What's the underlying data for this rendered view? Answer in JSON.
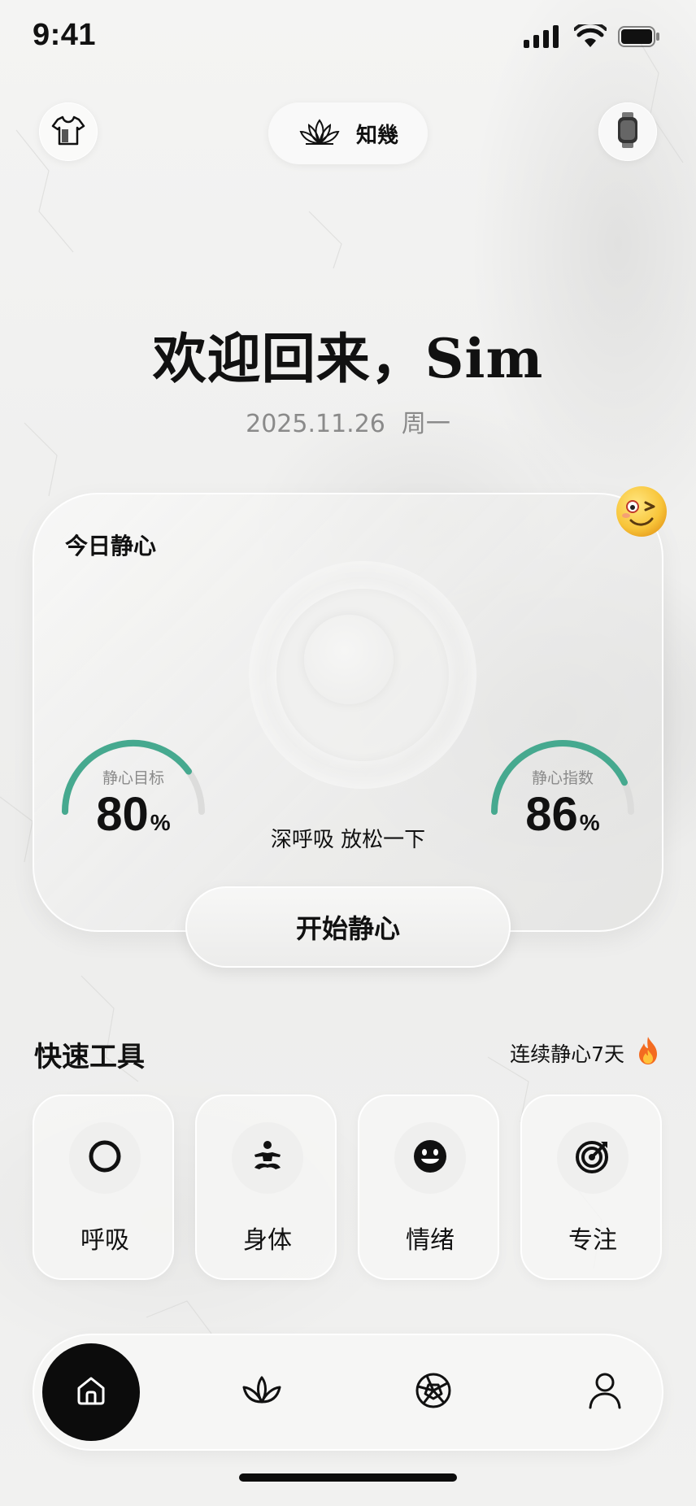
{
  "status_bar": {
    "time": "9:41",
    "icons": [
      "signal-icon",
      "wifi-icon",
      "battery-icon"
    ]
  },
  "top_bar": {
    "left_icon": "tshirt-icon",
    "brand": {
      "icon": "lotus-icon",
      "name": "知幾"
    },
    "right_icon": "watch-icon"
  },
  "welcome": {
    "greeting": "欢迎回来，Sim",
    "date": "2025.11.26",
    "weekday": "周一"
  },
  "calm_card": {
    "title": "今日静心",
    "badge_icon": "winking-face-emoji",
    "goal": {
      "label": "静心目标",
      "value": "80",
      "unit": "%",
      "fraction": 0.8
    },
    "index": {
      "label": "静心指数",
      "value": "86",
      "unit": "%",
      "fraction": 0.86
    },
    "hint": "深呼吸 放松一下",
    "start_button": "开始静心"
  },
  "quick_tools": {
    "title": "快速工具",
    "streak_text": "连续静心7天",
    "streak_icon": "fire-icon",
    "items": [
      {
        "label": "呼吸",
        "icon": "circle-icon"
      },
      {
        "label": "身体",
        "icon": "meditation-icon"
      },
      {
        "label": "情绪",
        "icon": "smiley-icon"
      },
      {
        "label": "专注",
        "icon": "target-icon"
      }
    ]
  },
  "bottom_nav": {
    "items": [
      {
        "icon": "home-icon",
        "active": true
      },
      {
        "icon": "lotus-icon",
        "active": false
      },
      {
        "icon": "aperture-icon",
        "active": false
      },
      {
        "icon": "user-icon",
        "active": false
      }
    ]
  },
  "colors": {
    "accent": "#46a98f",
    "track": "#dcdcdb",
    "text": "#111111",
    "muted": "#8a8a8a",
    "nav_active_bg": "#0c0c0c"
  }
}
